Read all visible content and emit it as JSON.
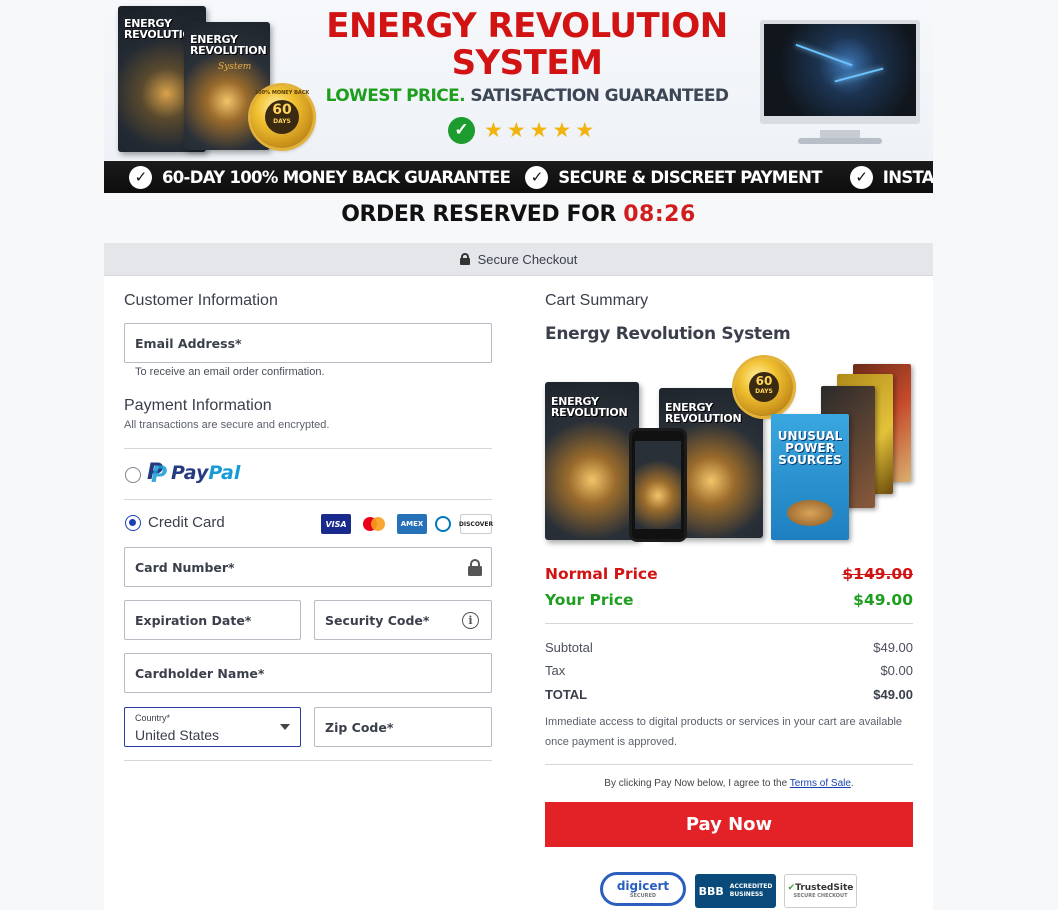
{
  "banner": {
    "title_line1": "ENERGY REVOLUTION",
    "title_line2": "SYSTEM",
    "subtitle_green": "LOWEST PRICE.",
    "subtitle_dark": "SATISFACTION GUARANTEED",
    "stars": 5,
    "product_box_title": "ENERGY REVOLUTION",
    "product_box_script": "System",
    "seal_top": "100% MONEY BACK",
    "seal_days": "60",
    "seal_days_label": "DAYS",
    "seal_bottom": "GUARANTEE",
    "guarantees": [
      "60-DAY 100% MONEY BACK GUARANTEE",
      "SECURE & DISCREET PAYMENT",
      "INSTANT ACCESS"
    ]
  },
  "timer": {
    "label": "ORDER RESERVED FOR",
    "time": "08:26"
  },
  "secure_checkout": "Secure Checkout",
  "customer": {
    "title": "Customer Information",
    "email_placeholder": "Email Address*",
    "email_hint": "To receive an email order confirmation."
  },
  "payment": {
    "title": "Payment Information",
    "subtitle": "All transactions are secure and encrypted.",
    "paypal_label": "PayPal",
    "paypal_pay": "Pay",
    "paypal_pal": "Pal",
    "credit_card_label": "Credit Card",
    "card_logos": [
      "VISA",
      "mastercard",
      "AMEX",
      "Diners",
      "DISCOVER"
    ],
    "card_number": "Card Number*",
    "expiration": "Expiration Date*",
    "security_code": "Security Code*",
    "cardholder": "Cardholder Name*",
    "country_label": "Country*",
    "country_value": "United States",
    "zip": "Zip Code*"
  },
  "cart": {
    "title": "Cart Summary",
    "product_name": "Energy Revolution System",
    "bonus_title": "UNUSUAL POWER SOURCES",
    "normal_price_label": "Normal Price",
    "normal_price": "$149.00",
    "your_price_label": "Your Price",
    "your_price": "$49.00",
    "subtotal_label": "Subtotal",
    "subtotal": "$49.00",
    "tax_label": "Tax",
    "tax": "$0.00",
    "total_label": "TOTAL",
    "total": "$49.00",
    "access_note": "Immediate access to digital products or services in your cart are available once payment is approved.",
    "terms_prefix": "By clicking Pay Now below, I agree to the",
    "terms_link": "Terms of Sale",
    "terms_suffix": ".",
    "pay_button": "Pay Now"
  },
  "trust_badges": {
    "digicert": "digicert",
    "digicert_sub": "SECURED",
    "bbb_line1": "ACCREDITED",
    "bbb_line2": "BUSINESS",
    "trustedsite": "TrustedSite",
    "trustedsite_sub": "SECURE CHECKOUT"
  },
  "colors": {
    "brand_red": "#d21313",
    "green": "#1e9e1e",
    "pay_button": "#e32227",
    "radio_selected": "#1b3fb8"
  }
}
